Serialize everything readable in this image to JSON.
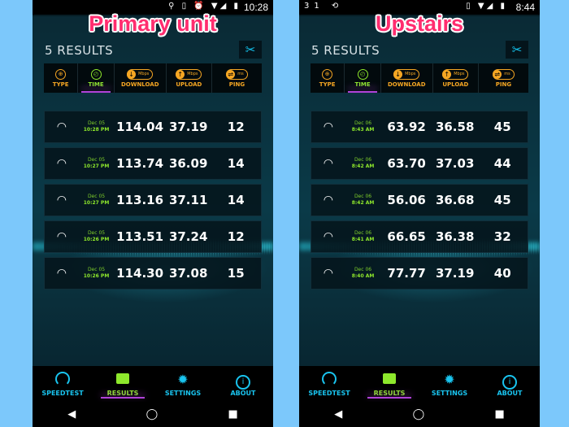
{
  "panels": [
    {
      "overlay_title": "Primary unit",
      "status_bar": {
        "time": "10:28",
        "left_icons": "",
        "right_icons": "⚲ ▯ ⏰ ▼◢ ▮"
      },
      "results_count": "5 RESULTS",
      "columns": [
        {
          "label": "TYPE",
          "icon": "globe-icon"
        },
        {
          "label": "TIME",
          "icon": "clock-icon",
          "active": true
        },
        {
          "label": "DOWNLOAD",
          "icon": "download-arrow-icon",
          "unit": "Mbps"
        },
        {
          "label": "UPLOAD",
          "icon": "upload-arrow-icon",
          "unit": "Mbps"
        },
        {
          "label": "PING",
          "icon": "ping-icon",
          "unit": "ms"
        }
      ],
      "rows": [
        {
          "date": "Dec 05",
          "time": "10:28 PM",
          "download": "114.04",
          "upload": "37.19",
          "ping": "12"
        },
        {
          "date": "Dec 05",
          "time": "10:27 PM",
          "download": "113.74",
          "upload": "36.09",
          "ping": "14"
        },
        {
          "date": "Dec 05",
          "time": "10:27 PM",
          "download": "113.16",
          "upload": "37.11",
          "ping": "14"
        },
        {
          "date": "Dec 05",
          "time": "10:26 PM",
          "download": "113.51",
          "upload": "37.24",
          "ping": "12"
        },
        {
          "date": "Dec 05",
          "time": "10:26 PM",
          "download": "114.30",
          "upload": "37.08",
          "ping": "15"
        }
      ]
    },
    {
      "overlay_title": "Upstairs",
      "status_bar": {
        "time": "8:44",
        "left_icons": "31 ⟲",
        "right_icons": "▯ ▼◢ ▮"
      },
      "results_count": "5 RESULTS",
      "columns": [
        {
          "label": "TYPE",
          "icon": "globe-icon"
        },
        {
          "label": "TIME",
          "icon": "clock-icon",
          "active": true
        },
        {
          "label": "DOWNLOAD",
          "icon": "download-arrow-icon",
          "unit": "Mbps"
        },
        {
          "label": "UPLOAD",
          "icon": "upload-arrow-icon",
          "unit": "Mbps"
        },
        {
          "label": "PING",
          "icon": "ping-icon",
          "unit": "ms"
        }
      ],
      "rows": [
        {
          "date": "Dec 06",
          "time": "8:43 AM",
          "download": "63.92",
          "upload": "36.58",
          "ping": "45"
        },
        {
          "date": "Dec 06",
          "time": "8:42 AM",
          "download": "63.70",
          "upload": "37.03",
          "ping": "44"
        },
        {
          "date": "Dec 06",
          "time": "8:42 AM",
          "download": "56.06",
          "upload": "36.68",
          "ping": "45"
        },
        {
          "date": "Dec 06",
          "time": "8:41 AM",
          "download": "66.65",
          "upload": "36.38",
          "ping": "32"
        },
        {
          "date": "Dec 06",
          "time": "8:40 AM",
          "download": "77.77",
          "upload": "37.19",
          "ping": "40"
        }
      ]
    }
  ],
  "bottom_nav": [
    {
      "label": "SPEEDTEST",
      "icon": "speedometer-icon"
    },
    {
      "label": "RESULTS",
      "icon": "results-folder-icon",
      "active": true
    },
    {
      "label": "SETTINGS",
      "icon": "gear-icon"
    },
    {
      "label": "ABOUT",
      "icon": "info-icon"
    }
  ],
  "glyphs": {
    "wifi": "◠",
    "tools": "✂",
    "gear": "✹",
    "info": "i",
    "back": "◀",
    "home": "◯",
    "recents": "■",
    "down": "↓",
    "up": "↑",
    "globe": "⊕",
    "clock": "◴",
    "ping": "⇌"
  },
  "colors": {
    "accent_orange": "#f5a623",
    "active_green": "#8ee82c",
    "nav_cyan": "#19c4ef",
    "highlight_purple": "#b042d8",
    "title_pink": "#ff2d6f"
  }
}
